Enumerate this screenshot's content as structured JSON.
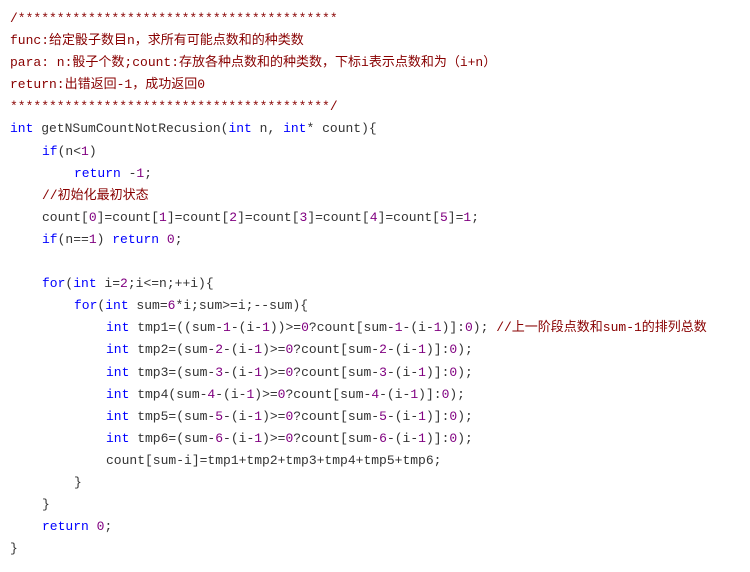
{
  "c1": "/*****************************************",
  "c2": "func:给定骰子数目n，求所有可能点数和的种类数",
  "c3": "para: n:骰子个数;count:存放各种点数和的种类数，下标i表示点数和为（i+n）",
  "c4": "return:出错返回-1，成功返回0",
  "c5": "*****************************************/",
  "sig_int": "int",
  "sig_name": " getNSumCountNotRecusion(",
  "sig_arg1_type": "int",
  "sig_arg1_name": " n, ",
  "sig_arg2_type": "int",
  "sig_arg2_name": "* count){",
  "if1_kw": "if",
  "if1_cond": "(n<",
  "if1_num": "1",
  "if1_close": ")",
  "ret1_kw": "return",
  "ret1_val": " -",
  "ret1_num": "1",
  "ret1_semi": ";",
  "c_init": "//初始化最初状态",
  "init_line_a": "count[",
  "n0": "0",
  "eq": "]=count[",
  "n1": "1",
  "n2": "2",
  "n3": "3",
  "n4": "4",
  "n5": "5",
  "eq1": "]=",
  "semi": ";",
  "if2_kw": "if",
  "if2_open": "(n==",
  "if2_num": "1",
  "if2_close": ") ",
  "ret2_kw": "return",
  "ret2_sp": " ",
  "ret2_num": "0",
  "for1_kw": "for",
  "for1_open": "(",
  "for1_int": "int",
  "for1_body": " i=",
  "for1_2": "2",
  "for1_rest": ";i<=n;++i){",
  "for2_kw": "for",
  "for2_open": "(",
  "for2_int": "int",
  "for2_body": " sum=",
  "for2_6": "6",
  "for2_rest": "*i;sum>=i;--sum){",
  "tmp1_int": "int",
  "tmp1_a": " tmp1=((sum-",
  "tmp1_n1": "1",
  "tmp1_b": "-(i-",
  "tmp1_n2": "1",
  "tmp1_c": "))>=",
  "tmp1_n3": "0",
  "tmp1_d": "?count[sum-",
  "tmp1_n4": "1",
  "tmp1_e": "-(i-",
  "tmp1_n5": "1",
  "tmp1_f": ")]:",
  "tmp1_n6": "0",
  "tmp1_g": "); ",
  "tmp1_comment": "//上一阶段点数和sum-1的排列总数",
  "tmp2_int": "int",
  "tmp2_a": " tmp2=(sum-",
  "tmp2_n1": "2",
  "tmp2_b": "-(i-",
  "tmp2_n2": "1",
  "tmp2_c": ")>=",
  "tmp2_n3": "0",
  "tmp2_d": "?count[sum-",
  "tmp2_n4": "2",
  "tmp2_e": "-(i-",
  "tmp2_n5": "1",
  "tmp2_f": ")]:",
  "tmp2_n6": "0",
  "tmp2_g": ");",
  "tmp3_int": "int",
  "tmp3_a": " tmp3=(sum-",
  "tmp3_n1": "3",
  "tmp3_b": "-(i-",
  "tmp3_n2": "1",
  "tmp3_c": ")>=",
  "tmp3_n3": "0",
  "tmp3_d": "?count[sum-",
  "tmp3_n4": "3",
  "tmp3_e": "-(i-",
  "tmp3_n5": "1",
  "tmp3_f": ")]:",
  "tmp3_n6": "0",
  "tmp3_g": ");",
  "tmp4_int": "int",
  "tmp4_a": " tmp4(sum-",
  "tmp4_n1": "4",
  "tmp4_b": "-(i-",
  "tmp4_n2": "1",
  "tmp4_c": ")>=",
  "tmp4_n3": "0",
  "tmp4_d": "?count[sum-",
  "tmp4_n4": "4",
  "tmp4_e": "-(i-",
  "tmp4_n5": "1",
  "tmp4_f": ")]:",
  "tmp4_n6": "0",
  "tmp4_g": ");",
  "tmp5_int": "int",
  "tmp5_a": " tmp5=(sum-",
  "tmp5_n1": "5",
  "tmp5_b": "-(i-",
  "tmp5_n2": "1",
  "tmp5_c": ")>=",
  "tmp5_n3": "0",
  "tmp5_d": "?count[sum-",
  "tmp5_n4": "5",
  "tmp5_e": "-(i-",
  "tmp5_n5": "1",
  "tmp5_f": ")]:",
  "tmp5_n6": "0",
  "tmp5_g": ");",
  "tmp6_int": "int",
  "tmp6_a": " tmp6=(sum-",
  "tmp6_n1": "6",
  "tmp6_b": "-(i-",
  "tmp6_n2": "1",
  "tmp6_c": ")>=",
  "tmp6_n3": "0",
  "tmp6_d": "?count[sum-",
  "tmp6_n4": "6",
  "tmp6_e": "-(i-",
  "tmp6_n5": "1",
  "tmp6_f": ")]:",
  "tmp6_n6": "0",
  "tmp6_g": ");",
  "assign": "count[sum-i]=tmp1+tmp2+tmp3+tmp4+tmp5+tmp6;",
  "brace_close": "}",
  "ret3_kw": "return",
  "ret3_sp": " ",
  "ret3_num": "0",
  "ret3_semi": ";"
}
